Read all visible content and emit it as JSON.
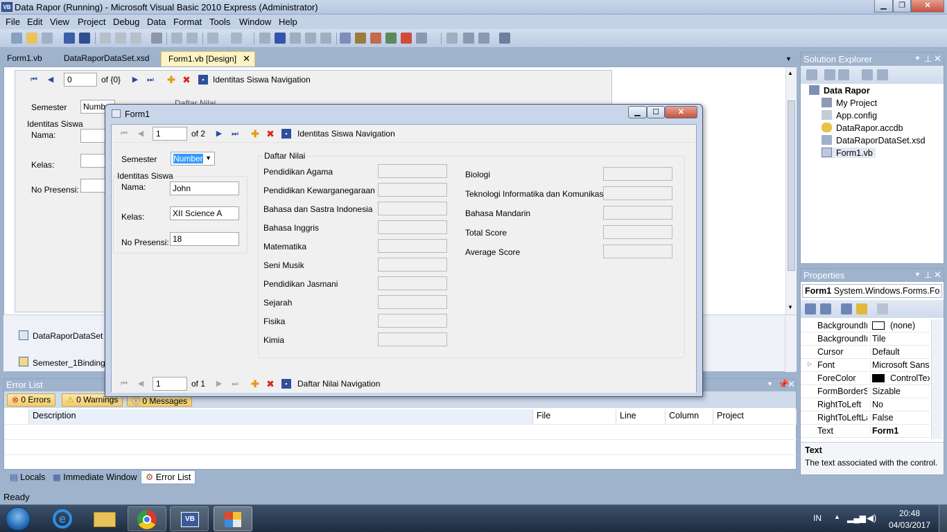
{
  "window": {
    "title": "Data Rapor (Running) - Microsoft Visual Basic 2010 Express (Administrator)",
    "icon_text": "VB",
    "controls": [
      "minimize-icon",
      "restore-icon",
      "close-icon"
    ]
  },
  "menu": [
    "File",
    "Edit",
    "View",
    "Project",
    "Debug",
    "Data",
    "Format",
    "Tools",
    "Window",
    "Help"
  ],
  "doc_tabs": [
    "Form1.vb",
    "DataRaporDataSet.xsd",
    "Form1.vb [Design]"
  ],
  "designer": {
    "nav": {
      "position": "0",
      "count": "of {0}",
      "label": "Identitas Siswa Navigation"
    },
    "semester_label": "Semester",
    "semester_value": "Number",
    "identitas_label": "Identitas Siswa",
    "nama_label": "Nama:",
    "kelas_label": "Kelas:",
    "presensi_label": "No Presensi:",
    "daftar_nilai_label": "Daftar Nilai",
    "tray": [
      "DataRaporDataSet",
      "Semester_1Binding"
    ]
  },
  "form1": {
    "title": "Form1",
    "top_nav": {
      "position": "1",
      "count": "of 2",
      "label": "Identitas Siswa Navigation"
    },
    "semester_label": "Semester",
    "semester_value": "Number",
    "identitas_label": "Identitas Siswa",
    "nama_label": "Nama:",
    "nama_value": "John",
    "kelas_label": "Kelas:",
    "kelas_value": "XII Science A",
    "presensi_label": "No Presensi:",
    "presensi_value": "18",
    "daftar_nilai_label": "Daftar Nilai",
    "subjects_left": [
      "Pendidikan Agama",
      "Pendidikan Kewarganegaraan",
      "Bahasa dan Sastra Indonesia",
      "Bahasa Inggris",
      "Matematika",
      "Seni Musik",
      "Pendidikan Jasmani",
      "Sejarah",
      "Fisika",
      "Kimia"
    ],
    "subjects_right": [
      "Biologi",
      "Teknologi Informatika dan Komunikasi",
      "Bahasa Mandarin",
      "Total Score",
      "Average Score"
    ],
    "bottom_nav": {
      "position": "1",
      "count": "of 1",
      "label": "Daftar Nilai Navigation"
    }
  },
  "solution_explorer": {
    "title": "Solution Explorer",
    "items": [
      "Data Rapor",
      "My Project",
      "App.config",
      "DataRapor.accdb",
      "DataRaporDataSet.xsd",
      "Form1.vb"
    ]
  },
  "properties": {
    "title": "Properties",
    "object": "Form1",
    "object_type": "System.Windows.Forms.Fo",
    "rows": [
      {
        "name": "BackgroundIr",
        "value": "(none)"
      },
      {
        "name": "BackgroundIr",
        "value": "Tile"
      },
      {
        "name": "Cursor",
        "value": "Default"
      },
      {
        "name": "Font",
        "value": "Microsoft Sans S"
      },
      {
        "name": "ForeColor",
        "value": "ControlTex"
      },
      {
        "name": "FormBorderSt",
        "value": "Sizable"
      },
      {
        "name": "RightToLeft",
        "value": "No"
      },
      {
        "name": "RightToLeftLa",
        "value": "False"
      },
      {
        "name": "Text",
        "value": "Form1"
      }
    ],
    "desc_title": "Text",
    "desc_text": "The text associated with the control."
  },
  "error_list": {
    "title": "Error List",
    "errors": "0 Errors",
    "warnings": "0 Warnings",
    "messages": "0 Messages",
    "columns": [
      "Description",
      "File",
      "Line",
      "Column",
      "Project"
    ]
  },
  "bottom_tabs": [
    "Locals",
    "Immediate Window",
    "Error List"
  ],
  "status": "Ready",
  "taskbar": {
    "lang": "IN",
    "time": "20:48",
    "date": "04/03/2017"
  }
}
